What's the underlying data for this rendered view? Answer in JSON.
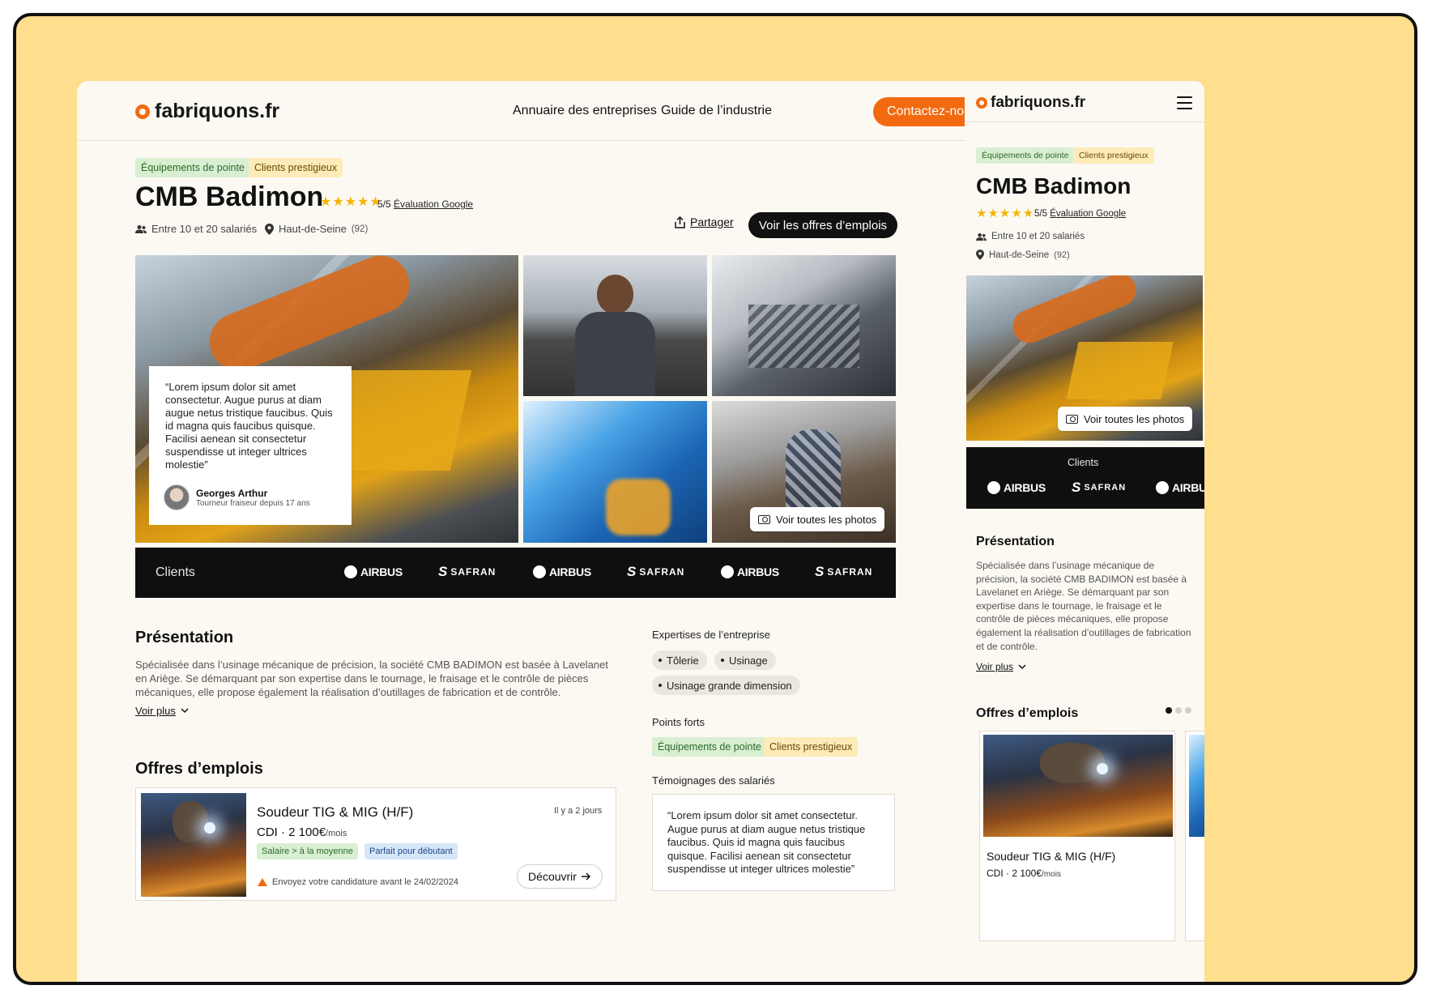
{
  "brand": {
    "name": "fabriquons.fr",
    "accent": "#F26A10",
    "dark": "#0F0F0F",
    "background": "#FFDE8E"
  },
  "nav": {
    "links": [
      "Annuaire des entreprises",
      "Guide de l’industrie"
    ],
    "cta": "Contactez-nous"
  },
  "company": {
    "tags": [
      "Équipements de pointe",
      "Clients prestigieux"
    ],
    "name": "CMB Badimon",
    "stars": "★★★★★",
    "rating": "5/5",
    "rating_source": "Évaluation Google",
    "employees": "Entre 10 et 20 salariés",
    "location": "Haut-de-Seine",
    "department": "(92)"
  },
  "actions": {
    "share": "Partager",
    "jobs_button": "Voir les offres d’emplois"
  },
  "gallery": {
    "photos": [
      "robot-arm-photo",
      "worker-portrait-photo",
      "stairs-machine-photo",
      "blue-production-line-photo",
      "grinder-worker-photo"
    ],
    "see_all": "Voir toutes les photos"
  },
  "testimonial_overlay": {
    "quote": "“Lorem ipsum dolor sit amet consectetur. Augue purus at diam augue netus tristique faucibus. Quis id magna quis faucibus quisque. Facilisi aenean sit consectetur suspendisse ut integer ultrices molestie”",
    "author": "Georges Arthur",
    "role": "Tourneur fraiseur depuis 17 ans"
  },
  "clients": {
    "label": "Clients",
    "logos": [
      "AIRBUS",
      "SAFRAN",
      "AIRBUS",
      "SAFRAN",
      "AIRBUS",
      "SAFRAN"
    ]
  },
  "presentation": {
    "title": "Présentation",
    "text": "Spécialisée dans l’usinage mécanique de précision, la société CMB BADIMON est basée à Lavelanet en Ariège. Se démarquant par son expertise dans le tournage, le fraisage et le contrôle de pièces mécaniques, elle propose également la réalisation d’outillages de fabrication et de contrôle.",
    "more": "Voir plus"
  },
  "expertises": {
    "title": "Expertises de l’entreprise",
    "items": [
      "Tôlerie",
      "Usinage",
      "Usinage grande dimension"
    ]
  },
  "strengths": {
    "title": "Points forts",
    "items": [
      "Équipements de pointe",
      "Clients prestigieux"
    ]
  },
  "testimonials": {
    "title": "Témoignages des salariés",
    "quote": "“Lorem ipsum dolor sit amet consectetur. Augue purus at diam augue netus tristique faucibus. Quis id magna quis faucibus quisque. Facilisi aenean sit consectetur suspendisse ut integer ultrices molestie”"
  },
  "jobs": {
    "title": "Offres d’emplois",
    "items": [
      {
        "title": "Soudeur TIG & MIG (H/F)",
        "contract": "CDI · 2 100€",
        "per": "/mois",
        "posted": "Il y a 2 jours",
        "tags": [
          "Salaire > à la moyenne",
          "Parfait pour débutant"
        ],
        "deadline": "Envoyez votre candidature avant le 24/02/2024",
        "cta": "Découvrir"
      }
    ],
    "carousel": {
      "pages": 3,
      "current": 1
    }
  },
  "icons": {
    "employees": "people-icon",
    "location": "map-pin-icon",
    "share": "share-icon",
    "camera": "camera-icon",
    "menu": "hamburger-menu-icon",
    "chevron": "chevron-down-icon",
    "warning": "warning-icon",
    "arrow": "arrow-right-icon"
  }
}
